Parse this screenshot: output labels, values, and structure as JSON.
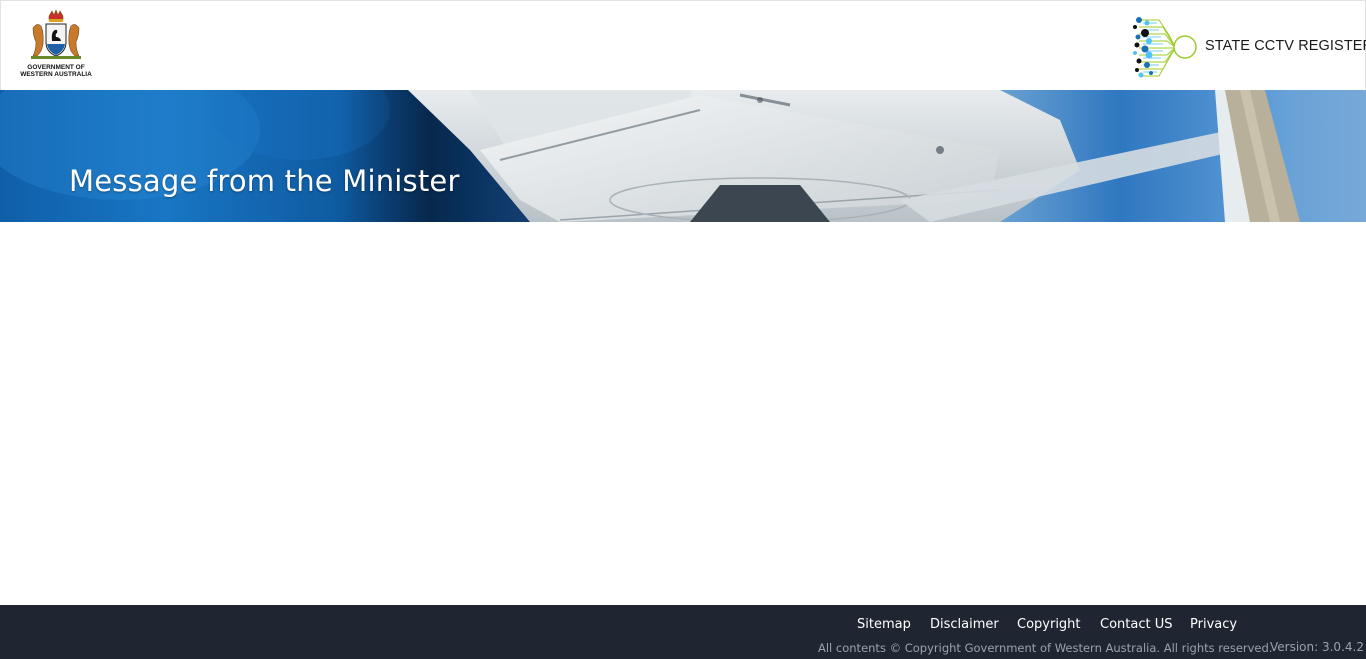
{
  "header": {
    "gov_logo": {
      "line1": "GOVERNMENT OF",
      "line2": "WESTERN AUSTRALIA",
      "icon": "coat-of-arms-icon"
    },
    "app_logo": {
      "title": "STATE CCTV REGISTER",
      "icon": "cctv-network-icon",
      "accent_colors": [
        "#1a6fb5",
        "#4fc3f7",
        "#9ccc2a",
        "#111111"
      ]
    }
  },
  "banner": {
    "title": "Message from the Minister"
  },
  "footer": {
    "links": [
      "Sitemap",
      "Disclaimer",
      "Copyright",
      "Contact US",
      "Privacy"
    ],
    "copyright": "All contents © Copyright Government of Western Australia. All rights reserved.",
    "version": "Version: 3.0.4.2",
    "background": "#1f2631"
  }
}
